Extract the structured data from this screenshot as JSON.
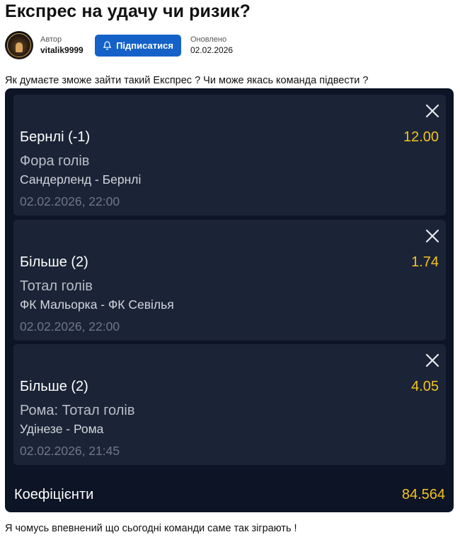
{
  "post": {
    "title": "Експрес на удачу чи ризик?",
    "author_caption": "Автор",
    "author_name": "vitalik9999",
    "subscribe_label": "Підписатися",
    "updated_caption": "Оновлено",
    "updated_date": "02.02.2026",
    "question": "Як думаєте зможе зайти такий Експрес ? Чи може якась команда підвести ?",
    "comment": "Я чомусь впевнений що сьогодні команди саме так зіграють !"
  },
  "slip": {
    "bets": [
      {
        "pick": "Бернлі (-1)",
        "odd": "12.00",
        "market": "Фора голів",
        "match": "Сандерленд - Бернлі",
        "time": "02.02.2026, 22:00"
      },
      {
        "pick": "Більше (2)",
        "odd": "1.74",
        "market": "Тотал голів",
        "match": "ФК Мальорка - ФК Севілья",
        "time": "02.02.2026, 22:00"
      },
      {
        "pick": "Більше (2)",
        "odd": "4.05",
        "market": "Рома: Тотал голів",
        "match": "Удінезе - Рома",
        "time": "02.02.2026, 21:45"
      }
    ],
    "total_label": "Коефіцієнти",
    "total_value": "84.564"
  },
  "colors": {
    "slip_bg": "#0c1425",
    "bet_bg": "#1b2436",
    "odd_accent": "#f5c320",
    "button_blue": "#1462c8"
  },
  "icons": {
    "subscribe": "bell-icon",
    "remove_bet": "close-icon"
  }
}
